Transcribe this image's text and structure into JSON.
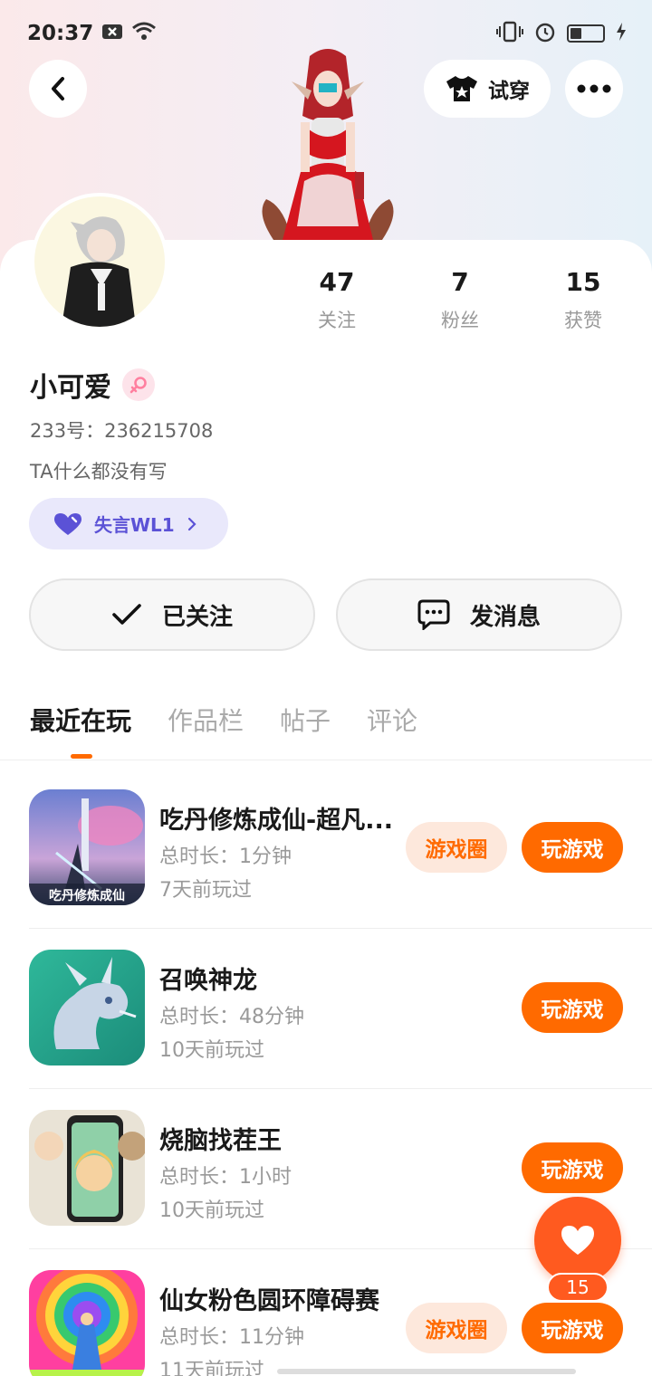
{
  "status_bar": {
    "time": "20:37"
  },
  "header": {
    "try_on_label": "试穿"
  },
  "profile": {
    "stats": [
      {
        "value": "47",
        "label": "关注"
      },
      {
        "value": "7",
        "label": "粉丝"
      },
      {
        "value": "15",
        "label": "获赞"
      }
    ],
    "username": "小可爱",
    "uid": "233号：236215708",
    "bio": "TA什么都没有写",
    "badge": "失言WL1"
  },
  "actions": {
    "following_label": "已关注",
    "message_label": "发消息"
  },
  "tabs": [
    {
      "label": "最近在玩",
      "active": true
    },
    {
      "label": "作品栏",
      "active": false
    },
    {
      "label": "帖子",
      "active": false
    },
    {
      "label": "评论",
      "active": false
    }
  ],
  "games": [
    {
      "title": "吃丹修炼成仙-超凡...",
      "icon_caption": "吃丹修炼成仙",
      "duration": "总时长：1分钟",
      "last_played": "7天前玩过",
      "circle_label": "游戏圈",
      "play_label": "玩游戏"
    },
    {
      "title": "召唤神龙",
      "duration": "总时长：48分钟",
      "last_played": "10天前玩过",
      "play_label": "玩游戏"
    },
    {
      "title": "烧脑找茬王",
      "duration": "总时长：1小时",
      "last_played": "10天前玩过",
      "play_label": "玩游戏"
    },
    {
      "title": "仙女粉色圆环障碍赛",
      "duration": "总时长：11分钟",
      "last_played": "11天前玩过",
      "circle_label": "游戏圈",
      "play_label": "玩游戏"
    }
  ],
  "fab": {
    "count": "15"
  },
  "colors": {
    "accent": "#ff6a00",
    "badge_purple": "#5b52d6",
    "badge_bg": "#e9e8fb"
  },
  "icons": [
    "back-icon",
    "shirt-icon",
    "more-icon",
    "female-icon",
    "heart-icon",
    "check-icon",
    "message-icon"
  ]
}
